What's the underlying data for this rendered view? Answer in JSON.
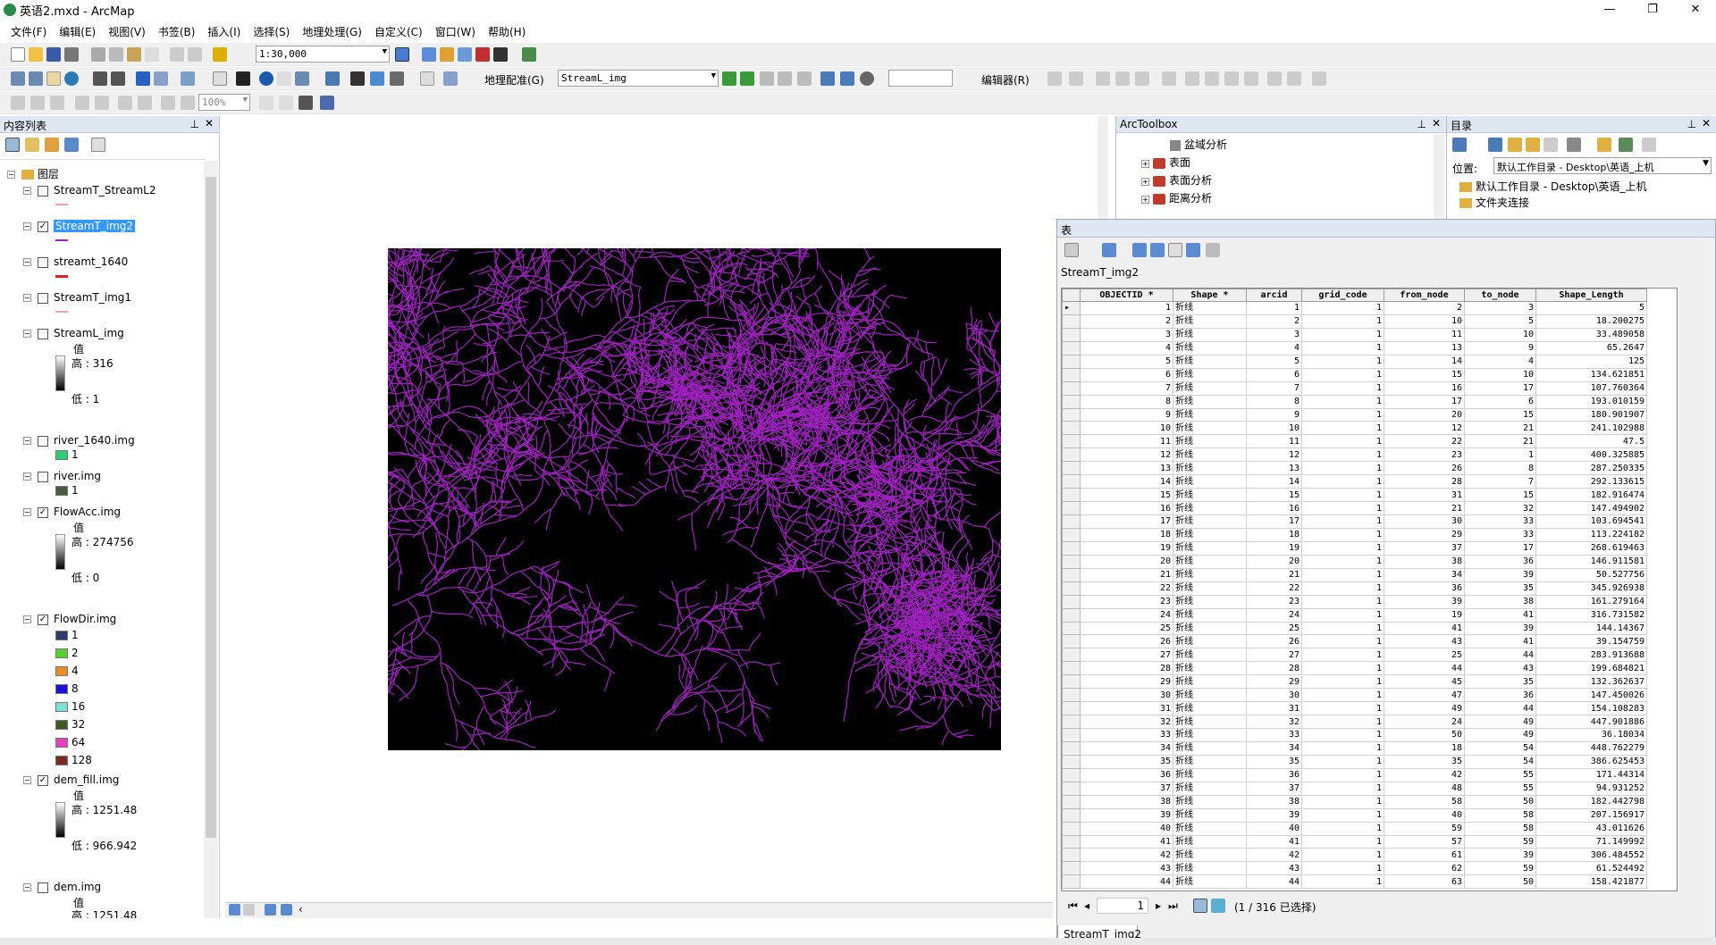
{
  "window": {
    "title": "英语2.mxd - ArcMap",
    "minimize": "—",
    "maximize": "❐",
    "close": "✕"
  },
  "menu": [
    "文件(F)",
    "编辑(E)",
    "视图(V)",
    "书签(B)",
    "插入(I)",
    "选择(S)",
    "地理处理(G)",
    "自定义(C)",
    "窗口(W)",
    "帮助(H)"
  ],
  "toolbar": {
    "scale": "1:30,000",
    "georef_label": "地理配准(G)",
    "georef_layer": "StreamL_img",
    "editor_label": "编辑器(R)",
    "zoom_pct": "100%"
  },
  "toc": {
    "title": "内容列表",
    "root": "图层",
    "layers": [
      {
        "name": "StreamT_StreamL2",
        "checked": false
      },
      {
        "name": "StreamT_img2",
        "checked": true,
        "selected": true
      },
      {
        "name": "streamt_1640",
        "checked": false
      },
      {
        "name": "StreamT_img1",
        "checked": false
      },
      {
        "name": "StreamL_img",
        "checked": false,
        "value_label": "值",
        "high": "高 : 316",
        "low": "低 : 1"
      },
      {
        "name": "river_1640.img",
        "checked": false,
        "class": "1",
        "color": "#2ecc71"
      },
      {
        "name": "river.img",
        "checked": false,
        "class": "1",
        "color": "#4a5a40"
      },
      {
        "name": "FlowAcc.img",
        "checked": true,
        "value_label": "值",
        "high": "高 : 274756",
        "low": "低 : 0"
      },
      {
        "name": "FlowDir.img",
        "checked": true
      },
      {
        "name": "dem_fill.img",
        "checked": true,
        "value_label": "值",
        "high": "高 : 1251.48",
        "low": "低 : 966.942"
      },
      {
        "name": "dem.img",
        "checked": false,
        "value_label": "值",
        "high": "高 : 1251.48"
      }
    ],
    "flowdir_classes": [
      {
        "label": "1",
        "color": "#2d3a6b"
      },
      {
        "label": "2",
        "color": "#55d12e"
      },
      {
        "label": "4",
        "color": "#f08a24"
      },
      {
        "label": "8",
        "color": "#1a10d8"
      },
      {
        "label": "16",
        "color": "#7fe0d6"
      },
      {
        "label": "32",
        "color": "#3e5a1f"
      },
      {
        "label": "64",
        "color": "#e83dbf"
      },
      {
        "label": "128",
        "color": "#7a2a1e"
      }
    ]
  },
  "toolbox": {
    "title": "ArcToolbox",
    "items": [
      "盆域分析",
      "表面",
      "表面分析",
      "距离分析"
    ]
  },
  "catalog": {
    "title": "目录",
    "location_label": "位置:",
    "location_value": "默认工作目录 - Desktop\\英语_上机",
    "items": [
      "默认工作目录 - Desktop\\英语_上机",
      "文件夹连接"
    ]
  },
  "table": {
    "window_title": "表",
    "layer_name": "StreamT_img2",
    "columns": [
      "OBJECTID *",
      "Shape *",
      "arcid",
      "grid_code",
      "from_node",
      "to_node",
      "Shape_Length"
    ],
    "rows": [
      [
        1,
        "折线",
        1,
        1,
        2,
        3,
        "5"
      ],
      [
        2,
        "折线",
        2,
        1,
        10,
        5,
        "18.200275"
      ],
      [
        3,
        "折线",
        3,
        1,
        11,
        10,
        "33.489058"
      ],
      [
        4,
        "折线",
        4,
        1,
        13,
        9,
        "65.2647"
      ],
      [
        5,
        "折线",
        5,
        1,
        14,
        4,
        "125"
      ],
      [
        6,
        "折线",
        6,
        1,
        15,
        10,
        "134.621851"
      ],
      [
        7,
        "折线",
        7,
        1,
        16,
        17,
        "107.760364"
      ],
      [
        8,
        "折线",
        8,
        1,
        17,
        6,
        "193.010159"
      ],
      [
        9,
        "折线",
        9,
        1,
        20,
        15,
        "180.901907"
      ],
      [
        10,
        "折线",
        10,
        1,
        12,
        21,
        "241.102988"
      ],
      [
        11,
        "折线",
        11,
        1,
        22,
        21,
        "47.5"
      ],
      [
        12,
        "折线",
        12,
        1,
        23,
        1,
        "400.325885"
      ],
      [
        13,
        "折线",
        13,
        1,
        26,
        8,
        "287.250335"
      ],
      [
        14,
        "折线",
        14,
        1,
        28,
        7,
        "292.133615"
      ],
      [
        15,
        "折线",
        15,
        1,
        31,
        15,
        "182.916474"
      ],
      [
        16,
        "折线",
        16,
        1,
        21,
        32,
        "147.494902"
      ],
      [
        17,
        "折线",
        17,
        1,
        30,
        33,
        "103.694541"
      ],
      [
        18,
        "折线",
        18,
        1,
        29,
        33,
        "113.224182"
      ],
      [
        19,
        "折线",
        19,
        1,
        37,
        17,
        "268.619463"
      ],
      [
        20,
        "折线",
        20,
        1,
        38,
        36,
        "146.911581"
      ],
      [
        21,
        "折线",
        21,
        1,
        34,
        39,
        "50.527756"
      ],
      [
        22,
        "折线",
        22,
        1,
        36,
        35,
        "345.926938"
      ],
      [
        23,
        "折线",
        23,
        1,
        39,
        38,
        "161.279164"
      ],
      [
        24,
        "折线",
        24,
        1,
        19,
        41,
        "316.731582"
      ],
      [
        25,
        "折线",
        25,
        1,
        41,
        39,
        "144.14367"
      ],
      [
        26,
        "折线",
        26,
        1,
        43,
        41,
        "39.154759"
      ],
      [
        27,
        "折线",
        27,
        1,
        25,
        44,
        "283.913688"
      ],
      [
        28,
        "折线",
        28,
        1,
        44,
        43,
        "199.684821"
      ],
      [
        29,
        "折线",
        29,
        1,
        45,
        35,
        "132.362637"
      ],
      [
        30,
        "折线",
        30,
        1,
        47,
        36,
        "147.450026"
      ],
      [
        31,
        "折线",
        31,
        1,
        49,
        44,
        "154.108283"
      ],
      [
        32,
        "折线",
        32,
        1,
        24,
        49,
        "447.901886"
      ],
      [
        33,
        "折线",
        33,
        1,
        50,
        49,
        "36.18034"
      ],
      [
        34,
        "折线",
        34,
        1,
        18,
        54,
        "448.762279"
      ],
      [
        35,
        "折线",
        35,
        1,
        35,
        54,
        "386.625453"
      ],
      [
        36,
        "折线",
        36,
        1,
        42,
        55,
        "171.44314"
      ],
      [
        37,
        "折线",
        37,
        1,
        48,
        55,
        "94.931252"
      ],
      [
        38,
        "折线",
        38,
        1,
        58,
        50,
        "182.442798"
      ],
      [
        39,
        "折线",
        39,
        1,
        40,
        58,
        "207.156917"
      ],
      [
        40,
        "折线",
        40,
        1,
        59,
        58,
        "43.011626"
      ],
      [
        41,
        "折线",
        41,
        1,
        57,
        59,
        "71.149992"
      ],
      [
        42,
        "折线",
        42,
        1,
        61,
        39,
        "306.484552"
      ],
      [
        43,
        "折线",
        43,
        1,
        62,
        59,
        "61.524492"
      ],
      [
        44,
        "折线",
        44,
        1,
        63,
        50,
        "158.421877"
      ]
    ],
    "current_record": "1",
    "status": "(1 / 316 已选择)",
    "tab": "StreamT_img2"
  }
}
